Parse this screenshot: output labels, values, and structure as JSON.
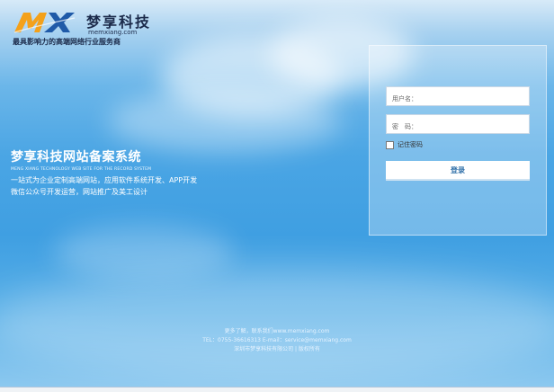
{
  "header": {
    "logo_mark": "MX",
    "logo_cn": "梦享科技",
    "logo_domain": "memxiang.com",
    "slogan": "最具影响力的高端网络行业服务商",
    "brand_colors": {
      "orange": "#f4a11a",
      "blue": "#1f5aa8",
      "dark": "#1b2a4a"
    }
  },
  "hero": {
    "title": "梦享科技网站备案系统",
    "subtitle_en": "MENG XIANG TECHNOLOGY WEB SITE FOR THE RECORD SYSTEM",
    "line1": "一站式为企业定制高端网站，应用软件系统开发、APP开发",
    "line2": "微信公众号开发运营，网站推广及美工设计"
  },
  "login": {
    "username_placeholder": "用户名：",
    "password_placeholder": "密　码：",
    "remember_label": "记住密码",
    "submit_label": "登录"
  },
  "footer": {
    "line1": "更多了解，联系我们www.memxiang.com",
    "line2": "TEL：0755-36616313   E-mail：service@memxiang.com",
    "line3": "深圳市梦享科技有限公司 | 版权所有"
  }
}
